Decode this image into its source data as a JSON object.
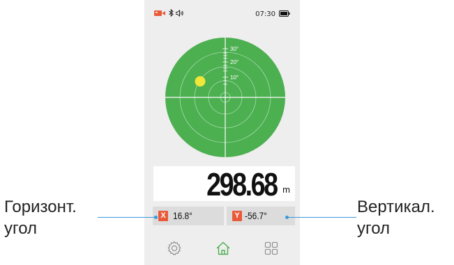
{
  "status": {
    "time": "07:30",
    "icons": [
      "camera-record-icon",
      "bluetooth-icon",
      "volume-icon",
      "battery-icon"
    ]
  },
  "radar": {
    "scale_labels": [
      "30°",
      "20°",
      "10°"
    ],
    "colors": {
      "field": "#4caf50",
      "bubble": "#f1e63a",
      "lines": "#a8dcae"
    }
  },
  "measurement": {
    "distance": "298.68",
    "unit": "m"
  },
  "angles": {
    "x_label": "X",
    "x_value": "16.8°",
    "y_label": "Y",
    "y_value": "-56.7°",
    "badge_color": "#e95a3a"
  },
  "nav": {
    "items": [
      "settings-icon",
      "home-icon",
      "grid-icon"
    ],
    "active_color": "#4caf50"
  },
  "annotations": {
    "left_line1": "Горизонт.",
    "left_line2": "угол",
    "right_line1": "Вертикал.",
    "right_line2": "угол",
    "line_color": "#3a9ad9"
  }
}
